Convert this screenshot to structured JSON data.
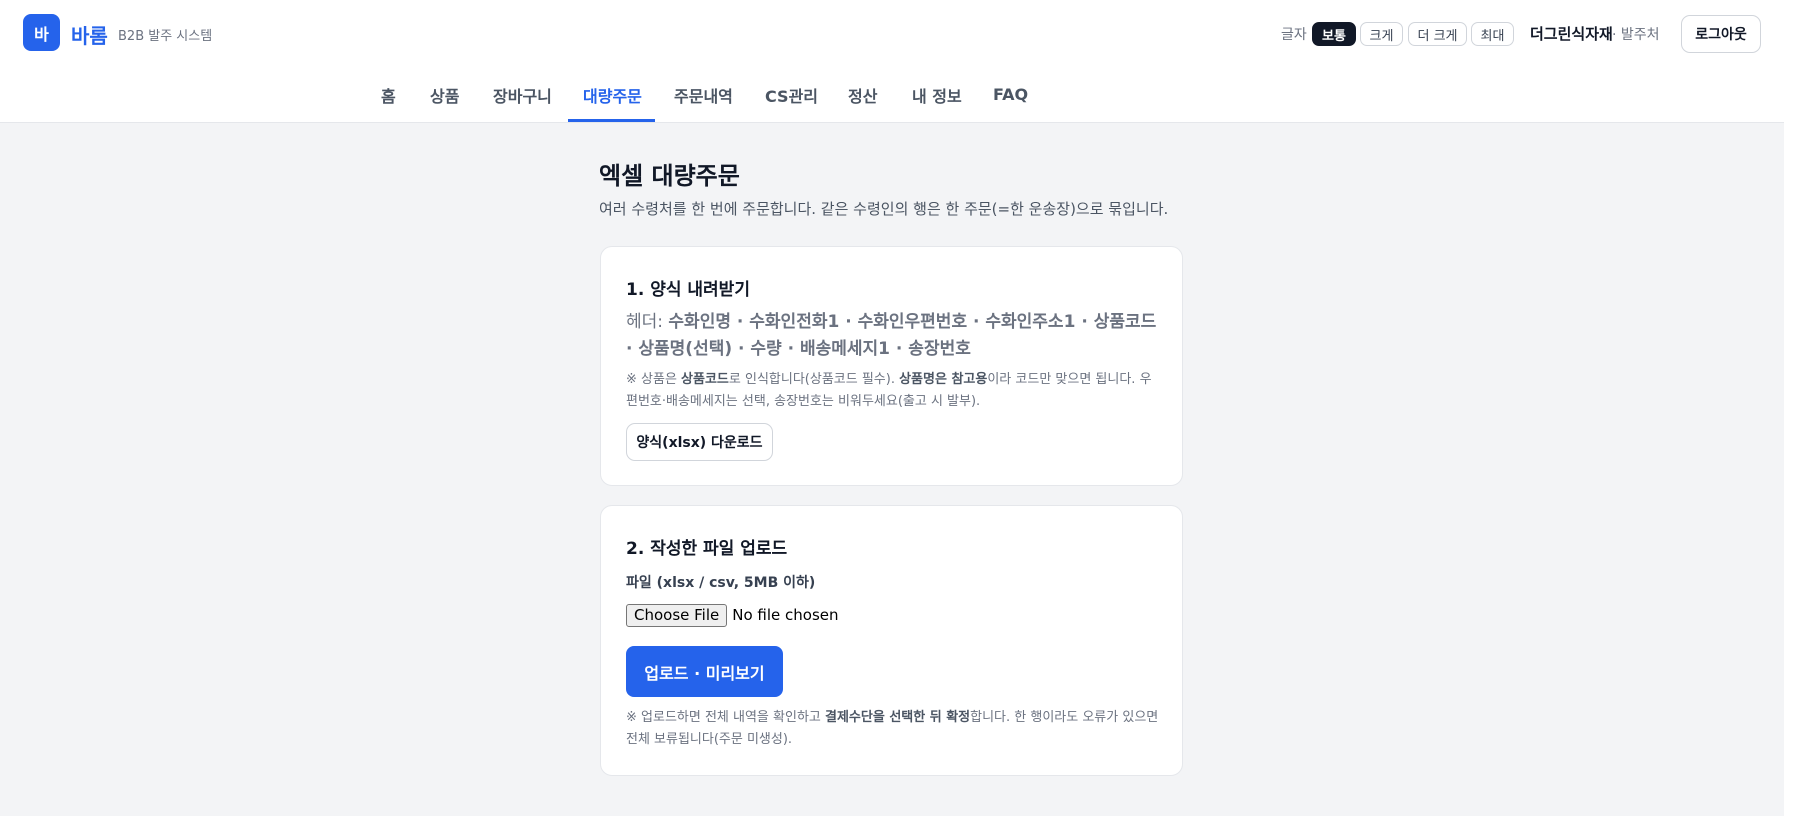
{
  "brand": {
    "logo_text": "바",
    "name": "바롬",
    "subtitle": "B2B 발주 시스템"
  },
  "header": {
    "font_size_label": "글자",
    "font_sizes": [
      "보통",
      "크게",
      "더 크게",
      "최대"
    ],
    "active_font_size": "보통",
    "company": "더그린식자재",
    "role": "· 발주처",
    "logout_label": "로그아웃"
  },
  "nav": {
    "items": [
      "홈",
      "상품",
      "장바구니",
      "대량주문",
      "주문내역",
      "CS관리",
      "정산",
      "내 정보",
      "FAQ"
    ],
    "active": "대량주문"
  },
  "page": {
    "title": "엑셀 대량주문",
    "subtitle": "여러 수령처를 한 번에 주문합니다. 같은 수령인의 행은 한 주문(=한 운송장)으로 묶입니다."
  },
  "step1": {
    "title": "1. 양식 내려받기",
    "header_prefix": "헤더: ",
    "header_fields": "수화인명 · 수화인전화1 · 수화인우편번호 · 수화인주소1 · 상품코드 · 상품명(선택) · 수량 · 배송메세지1 · 송장번호",
    "note_part1": "※ 상품은 ",
    "note_bold1": "상품코드",
    "note_part2": "로 인식합니다(상품코드 필수). ",
    "note_bold2": "상품명은 참고용",
    "note_part3": "이라 코드만 맞으면 됩니다. 우편번호·배송메세지는 선택, 송장번호는 비워두세요(출고 시 발부).",
    "download_label": "양식(xlsx) 다운로드"
  },
  "step2": {
    "title": "2. 작성한 파일 업로드",
    "file_label": "파일 (xlsx / csv, 5MB 이하)",
    "choose_label": "Choose File",
    "file_status": "No file chosen",
    "upload_label": "업로드 · 미리보기",
    "note_part1": "※ 업로드하면 전체 내역을 확인하고 ",
    "note_bold": "결제수단을 선택한 뒤 확정",
    "note_part2": "합니다. 한 행이라도 오류가 있으면 전체 보류됩니다(주문 미생성)."
  },
  "colors": {
    "accent": "#2563eb",
    "active_font_btn": "#111827",
    "page_bg": "#f3f4f6"
  }
}
